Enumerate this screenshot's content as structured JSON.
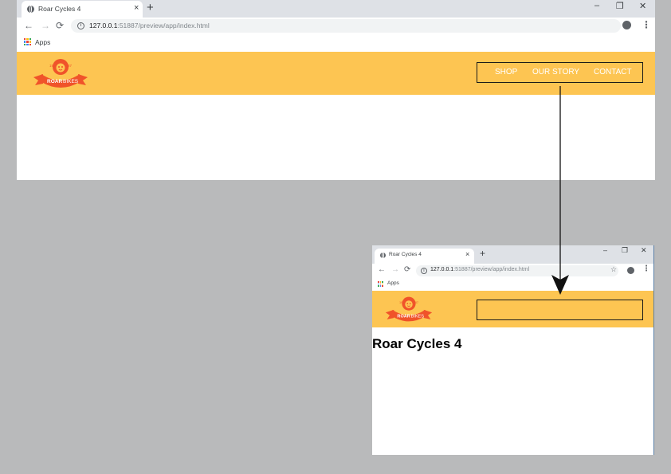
{
  "windows": {
    "large": {
      "tab_title": "Roar Cycles 4",
      "url": {
        "host": "127.0.0.1",
        "path": ":51887/preview/app/index.html"
      },
      "bookmarks": {
        "apps_label": "Apps"
      },
      "nav": {
        "shop": "SHOP",
        "our_story": "OUR STORY",
        "contact": "CONTACT"
      }
    },
    "small": {
      "tab_title": "Roar Cycles 4",
      "url": {
        "host": "127.0.0.1",
        "path": ":51887/preview/app/index.html"
      },
      "bookmarks": {
        "apps_label": "Apps"
      },
      "page_heading": "Roar Cycles 4"
    }
  },
  "browser": {
    "close_glyph": "×",
    "new_tab_glyph": "+",
    "minimize_glyph": "–",
    "restore_glyph": "❐",
    "window_close_glyph": "✕",
    "back_glyph": "←",
    "forward_glyph": "→",
    "reload_glyph": "⟳",
    "info_glyph": "i",
    "star_glyph": "☆",
    "menu_glyph": "⋮"
  },
  "logo": {
    "text_left": "ROAR",
    "text_right": "BIKES",
    "badge_left": "19",
    "badge_right": "87"
  },
  "colors": {
    "header": "#fdc552",
    "logo_orange": "#f0532a",
    "apps_grid": [
      "#ea4335",
      "#fbbc05",
      "#34a853",
      "#4285f4",
      "#ea4335",
      "#fbbc05",
      "#34a853",
      "#4285f4",
      "#ea4335"
    ]
  }
}
